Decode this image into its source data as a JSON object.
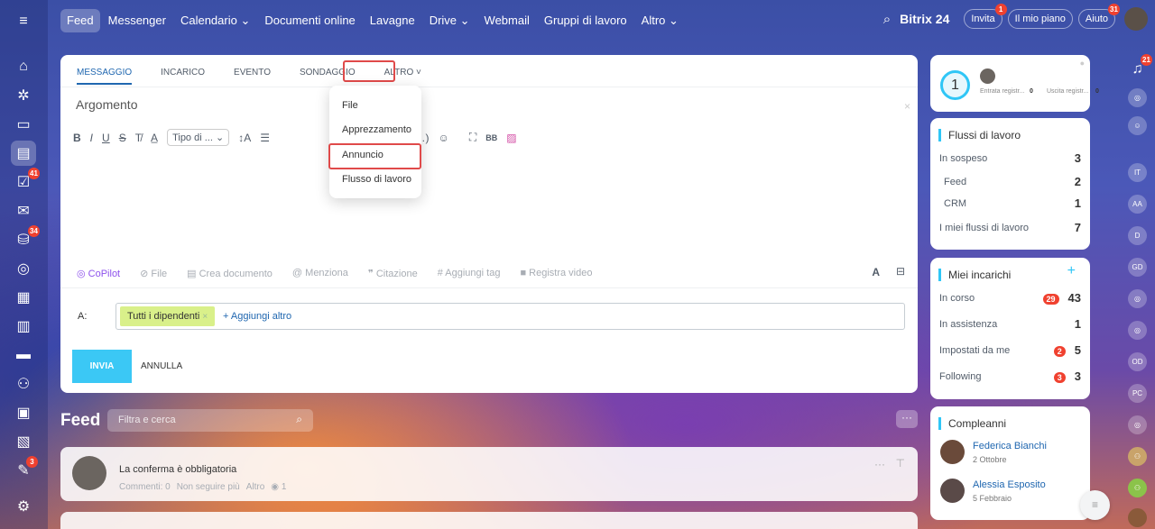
{
  "topnav": {
    "items": [
      "Feed",
      "Messenger",
      "Calendario ⌄",
      "Documenti online",
      "Lavagne",
      "Drive ⌄",
      "Webmail",
      "Gruppi di lavoro",
      "Altro ⌄"
    ],
    "brand": "Bitrix 24",
    "invite": "Invita",
    "invite_badge": "1",
    "plan": "Il mio piano",
    "help": "Aiuto",
    "help_badge": "31"
  },
  "leftnav": {
    "badges": {
      "tasks": "41",
      "feed": "34",
      "mail": "3"
    }
  },
  "composer": {
    "tabs": [
      "Messaggio",
      "Incarico",
      "Evento",
      "Sondaggio",
      "Altro ˅"
    ],
    "subject_placeholder": "Argomento",
    "font_select": "Tipo di ...",
    "dropdown": [
      "File",
      "Apprezzamento",
      "Annuncio",
      "Flusso di lavoro"
    ],
    "bottom": [
      "CoPilot",
      "File",
      "Crea documento",
      "Menziona",
      "Citazione",
      "Aggiungi tag",
      "Registra video"
    ],
    "to_label": "A:",
    "recipient": "Tutti i dipendenti",
    "add_more": "+ Aggiungi altro",
    "send": "INVIA",
    "cancel": "ANNULLA"
  },
  "feed": {
    "title": "Feed",
    "filter_placeholder": "Filtra e cerca",
    "post": {
      "text": "La conferma è obbligatoria",
      "meta": [
        "Commenti: 0",
        "Non seguire più",
        "Altro",
        "1"
      ]
    }
  },
  "timeman": {
    "number": "1",
    "entry": "Entrata registr...",
    "entry_val": "0",
    "exit": "Uscita registr...",
    "exit_val": "0"
  },
  "workflows": {
    "title": "Flussi di lavoro",
    "rows": [
      {
        "label": "In sospeso",
        "val": "3"
      },
      {
        "label": "Feed",
        "val": "2"
      },
      {
        "label": "CRM",
        "val": "1"
      },
      {
        "label": "I miei flussi di lavoro",
        "val": "7"
      }
    ]
  },
  "tasks": {
    "title": "Miei incarichi",
    "add": "+",
    "rows": [
      {
        "label": "In corso",
        "badge": "29",
        "val": "43"
      },
      {
        "label": "In assistenza",
        "badge": "",
        "val": "1"
      },
      {
        "label": "Impostati da me",
        "badge": "2",
        "val": "5"
      },
      {
        "label": "Following",
        "badge": "3",
        "val": "3"
      }
    ]
  },
  "birthdays": {
    "title": "Compleanni",
    "people": [
      {
        "name": "Federica Bianchi",
        "date": "2 Ottobre"
      },
      {
        "name": "Alessia Esposito",
        "date": "5 Febbraio"
      }
    ]
  },
  "rightbar": {
    "notif_badge": "21",
    "avatars": [
      "IT",
      "AA",
      "D",
      "GD",
      "OD",
      "PC"
    ]
  }
}
